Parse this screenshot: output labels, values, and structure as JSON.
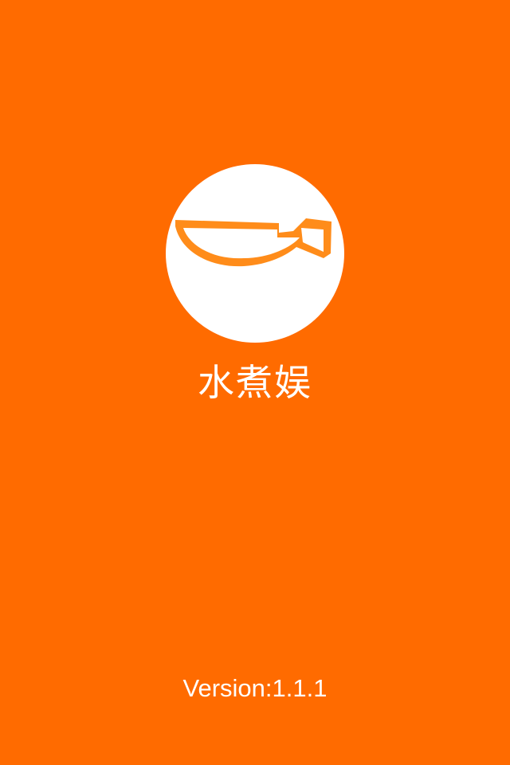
{
  "splash": {
    "background_color": "#ff6b00",
    "logo_icon": "wok-icon",
    "app_name": "水煮娱",
    "version_text": "Version:1.1.1"
  }
}
